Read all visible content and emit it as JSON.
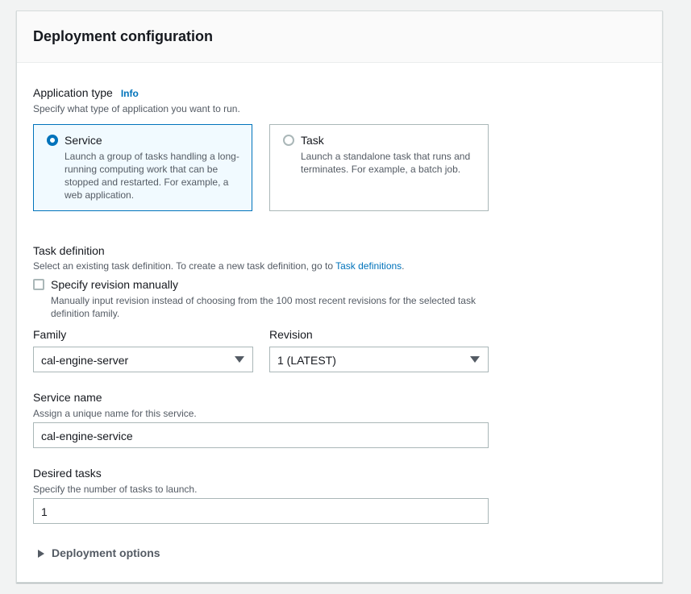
{
  "panel": {
    "title": "Deployment configuration"
  },
  "application_type": {
    "label": "Application type",
    "info": "Info",
    "description": "Specify what type of application you want to run.",
    "options": [
      {
        "title": "Service",
        "description": "Launch a group of tasks handling a long-running computing work that can be stopped and restarted. For example, a web application.",
        "selected": true
      },
      {
        "title": "Task",
        "description": "Launch a standalone task that runs and terminates. For example, a batch job.",
        "selected": false
      }
    ]
  },
  "task_definition": {
    "label": "Task definition",
    "description_prefix": "Select an existing task definition. To create a new task definition, go to",
    "link": "Task definitions",
    "description_suffix": ".",
    "manual_checkbox": {
      "label": "Specify revision manually",
      "description": "Manually input revision instead of choosing from the 100 most recent revisions for the selected task definition family.",
      "checked": false
    },
    "family": {
      "label": "Family",
      "value": "cal-engine-server"
    },
    "revision": {
      "label": "Revision",
      "value": "1 (LATEST)"
    }
  },
  "service_name": {
    "label": "Service name",
    "description": "Assign a unique name for this service.",
    "value": "cal-engine-service"
  },
  "desired_tasks": {
    "label": "Desired tasks",
    "description": "Specify the number of tasks to launch.",
    "value": "1"
  },
  "deployment_options": {
    "label": "Deployment options",
    "expanded": false
  },
  "colors": {
    "accent": "#0073bb",
    "selected_bg": "#f1faff",
    "border": "#aab7b8",
    "text": "#16191f",
    "secondary_text": "#545b64"
  },
  "icons": {
    "select_caret": "caret-down-icon",
    "expander": "caret-right-icon"
  }
}
